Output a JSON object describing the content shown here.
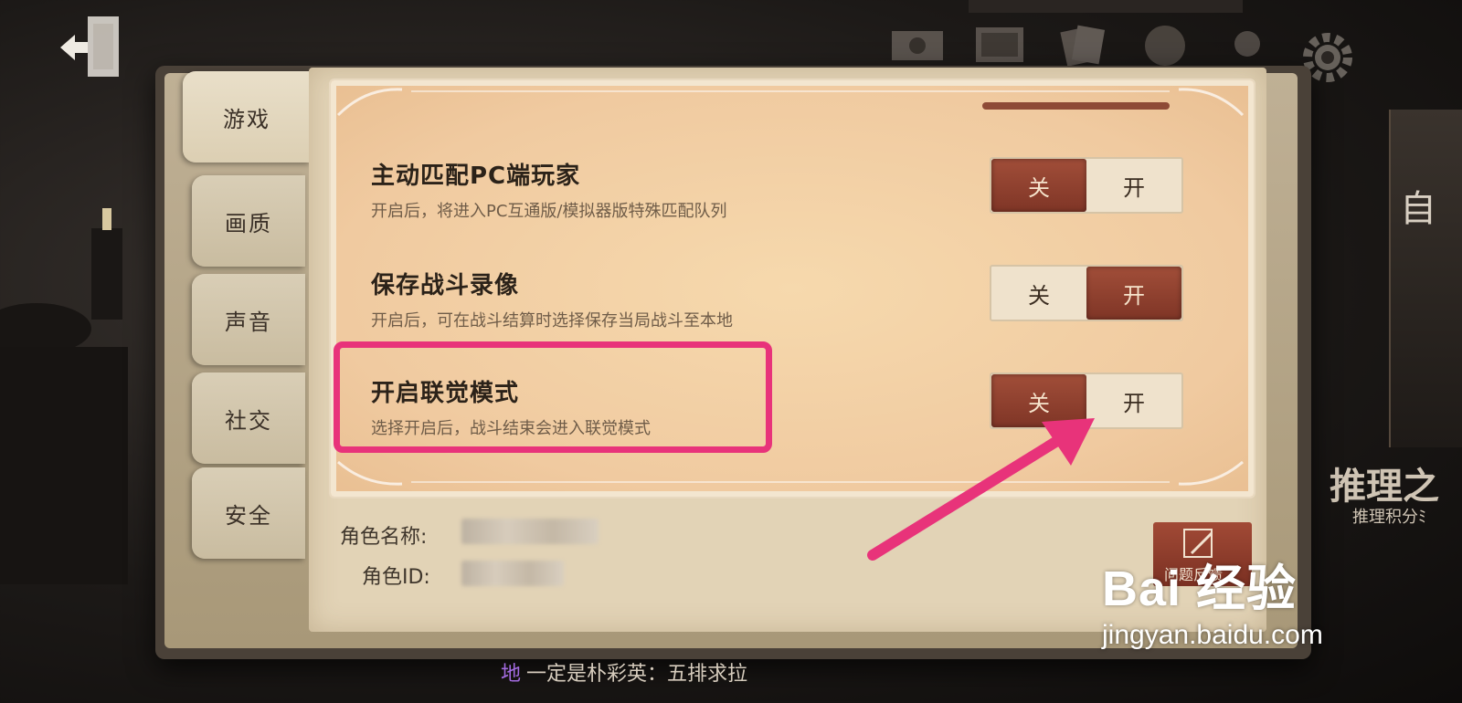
{
  "tabs": [
    "游戏",
    "画质",
    "声音",
    "社交",
    "安全"
  ],
  "active_tab": "游戏",
  "settings": [
    {
      "title": "主动匹配PC端玩家",
      "desc": "开启后，将进入PC互通版/模拟器版特殊匹配队列",
      "off_label": "关",
      "on_label": "开",
      "selected": "off"
    },
    {
      "title": "保存战斗录像",
      "desc": "开启后，可在战斗结算时选择保存当局战斗至本地",
      "off_label": "关",
      "on_label": "开",
      "selected": "on"
    },
    {
      "title": "开启联觉模式",
      "desc": "选择开启后，战斗结束会进入联觉模式",
      "off_label": "关",
      "on_label": "开",
      "selected": "off"
    }
  ],
  "footer": {
    "name_label": "角色名称:",
    "id_label": "角色ID:"
  },
  "feedback_label": "问题反馈",
  "chat": {
    "channel": "地",
    "message": "一定是朴彩英：五排求拉"
  },
  "right_side": {
    "text1": "自",
    "text2": "推理之",
    "text3": "推理积分ﾐ"
  },
  "watermark": {
    "main": "Bai 经验",
    "sub": "jingyan.baidu.com"
  },
  "colors": {
    "accent": "#e8337a",
    "toggle_on": "#8e3e2c",
    "card": "#f3d3a6"
  }
}
